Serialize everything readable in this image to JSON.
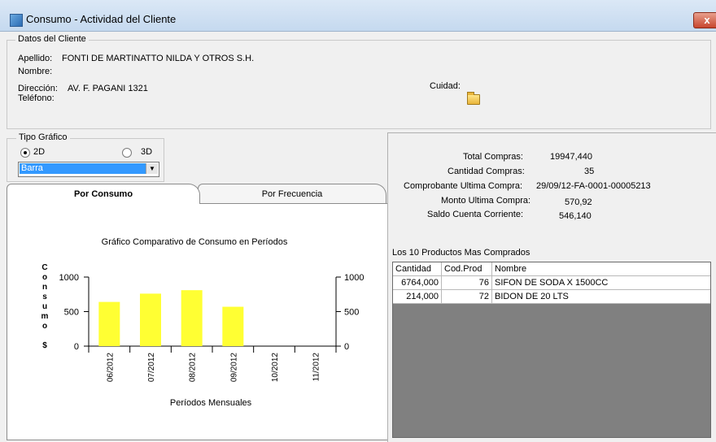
{
  "window": {
    "title": "Consumo - Actividad del Cliente",
    "close_label": "x"
  },
  "client": {
    "group_label": "Datos del Cliente",
    "apellido_label": "Apellido:",
    "apellido_value": "FONTI DE MARTINATTO NILDA Y OTROS  S.H.",
    "nombre_label": "Nombre:",
    "nombre_value": "",
    "direccion_label": "Dirección:",
    "direccion_value": "AV. F. PAGANI  1321",
    "telefono_label": "Teléfono:",
    "telefono_value": "",
    "ciudad_label": "Cuidad:",
    "ciudad_value": ""
  },
  "chart_type": {
    "group_label": "Tipo Gráfico",
    "option_2d": "2D",
    "option_3d": "3D",
    "selected": "2D",
    "select_value": "Barra"
  },
  "tabs": [
    {
      "label": "Por Consumo",
      "active": true
    },
    {
      "label": "Por Frecuencia",
      "active": false
    }
  ],
  "summary": {
    "total_compras_label": "Total Compras:",
    "total_compras_value": "19947,440",
    "cantidad_compras_label": "Cantidad Compras:",
    "cantidad_compras_value": "35",
    "comprobante_label": "Comprobante Ultima Compra:",
    "comprobante_value": "29/09/12-FA-0001-00005213",
    "monto_label": "Monto Ultima Compra:",
    "monto_value": "570,92",
    "saldo_label": "Saldo Cuenta Corriente:",
    "saldo_value": "546,140"
  },
  "products": {
    "title": "Los 10 Productos Mas Comprados",
    "columns": [
      "Cantidad",
      "Cod.Prod",
      "Nombre"
    ],
    "rows": [
      {
        "cantidad": "6764,000",
        "cod": "76",
        "nombre": "SIFON DE SODA X 1500CC"
      },
      {
        "cantidad": "214,000",
        "cod": "72",
        "nombre": "BIDON DE 20 LTS"
      }
    ]
  },
  "chart_data": {
    "type": "bar",
    "title": "Gráfico Comparativo de Consumo en Períodos",
    "xlabel": "Períodos Mensuales",
    "ylabel": "Consumo $",
    "ylabel_chars": [
      "C",
      "o",
      "n",
      "s",
      "u",
      "m",
      "o",
      "",
      "$"
    ],
    "categories": [
      "06/2012",
      "07/2012",
      "08/2012",
      "09/2012",
      "10/2012",
      "11/2012"
    ],
    "values": [
      640,
      760,
      810,
      570,
      0,
      0
    ],
    "ylim": [
      0,
      1000
    ],
    "yticks": [
      "0",
      "500",
      "1000"
    ],
    "bar_color": "#ffff33",
    "grid": false,
    "secondary_axis": true
  }
}
